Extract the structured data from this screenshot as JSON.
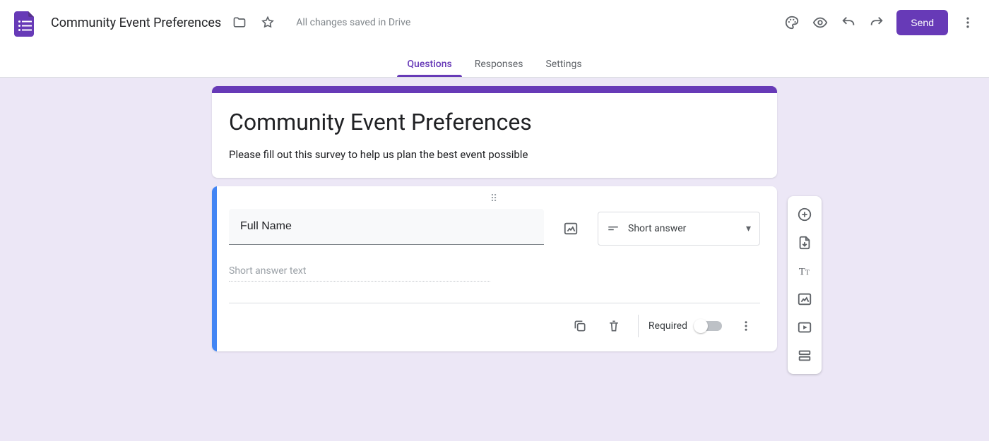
{
  "header": {
    "doc_title": "Community Event Preferences",
    "save_status": "All changes saved in Drive",
    "send_label": "Send"
  },
  "tabs": {
    "questions": "Questions",
    "responses": "Responses",
    "settings": "Settings",
    "active": "questions"
  },
  "form": {
    "title": "Community Event Preferences",
    "description": "Please fill out this survey to help us plan the best event possible"
  },
  "question": {
    "text": "Full Name",
    "type_label": "Short answer",
    "answer_hint": "Short answer text",
    "required_label": "Required",
    "required_on": false
  },
  "side_tools": {
    "add_question": "add-question",
    "import_questions": "import-questions",
    "add_title": "add-title",
    "add_image": "add-image",
    "add_video": "add-video",
    "add_section": "add-section"
  },
  "colors": {
    "accent": "#673ab7",
    "workspace_bg": "#ece7f6"
  }
}
